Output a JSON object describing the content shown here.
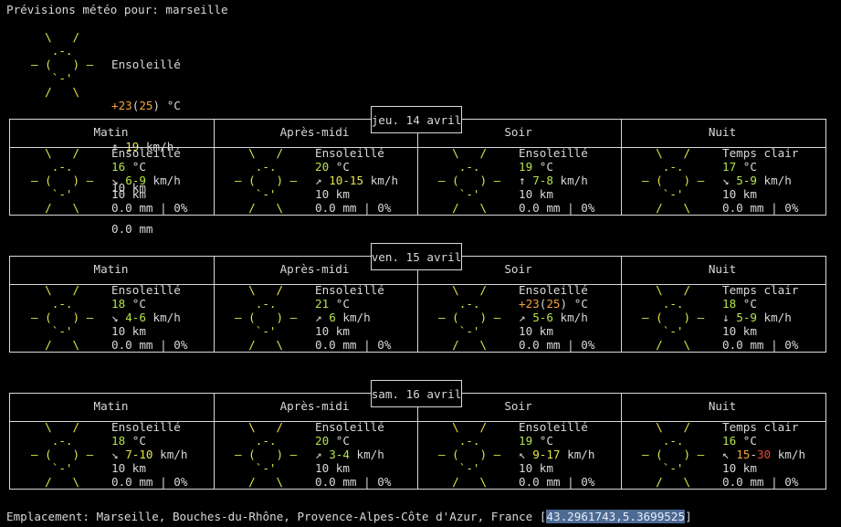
{
  "header": {
    "title": "Prévisions météo pour: marseille"
  },
  "current": {
    "art": "  \\   /\n   .-.\n― (   ) ―\n   `-'\n  /   \\",
    "condition": "Ensoleillé",
    "temp": "+23",
    "temp_feels": "25",
    "temp_unit": " °C",
    "wind_arrow": "↑",
    "wind_speed": "19",
    "wind_unit": " km/h",
    "visibility": "10 km",
    "precip": "0.0 mm"
  },
  "period_headers": [
    "Matin",
    "Après-midi",
    "Soir",
    "Nuit"
  ],
  "days": [
    {
      "date": "jeu. 14 avril",
      "periods": [
        {
          "condition": "Ensoleillé",
          "temp": "16",
          "temp_unit": " °C",
          "wind_arrow": "↘",
          "wind": "6-9",
          "wind_unit": " km/h",
          "visibility": "10 km",
          "precip": "0.0 mm | 0%",
          "art": "  \\   /\n   .-.\n― (   ) ―\n   `-'\n  /   \\"
        },
        {
          "condition": "Ensoleillé",
          "temp": "20",
          "temp_unit": " °C",
          "wind_arrow": "↗",
          "wind": "10-15",
          "wind_unit": " km/h",
          "visibility": "10 km",
          "precip": "0.0 mm | 0%",
          "art": "  \\   /\n   .-.\n― (   ) ―\n   `-'\n  /   \\"
        },
        {
          "condition": "Ensoleillé",
          "temp": "19",
          "temp_unit": " °C",
          "wind_arrow": "↑",
          "wind": "7-8",
          "wind_unit": " km/h",
          "visibility": "10 km",
          "precip": "0.0 mm | 0%",
          "art": "  \\   /\n   .-.\n― (   ) ―\n   `-'\n  /   \\"
        },
        {
          "condition": "Temps clair",
          "temp": "17",
          "temp_unit": " °C",
          "wind_arrow": "↘",
          "wind": "5-9",
          "wind_unit": " km/h",
          "visibility": "10 km",
          "precip": "0.0 mm | 0%",
          "art": "  \\   /\n   .-.\n― (   ) ―\n   `-'\n  /   \\"
        }
      ]
    },
    {
      "date": "ven. 15 avril",
      "periods": [
        {
          "condition": "Ensoleillé",
          "temp": "18",
          "temp_unit": " °C",
          "wind_arrow": "↘",
          "wind": "4-6",
          "wind_unit": " km/h",
          "visibility": "10 km",
          "precip": "0.0 mm | 0%",
          "art": "  \\   /\n   .-.\n― (   ) ―\n   `-'\n  /   \\"
        },
        {
          "condition": "Ensoleillé",
          "temp": "21",
          "temp_unit": " °C",
          "wind_arrow": "↗",
          "wind": "6",
          "wind_unit": " km/h",
          "visibility": "10 km",
          "precip": "0.0 mm | 0%",
          "art": "  \\   /\n   .-.\n― (   ) ―\n   `-'\n  /   \\"
        },
        {
          "condition": "Ensoleillé",
          "temp": "+23",
          "temp_feels": "25",
          "temp_unit": " °C",
          "wind_arrow": "↗",
          "wind": "5-6",
          "wind_unit": " km/h",
          "visibility": "10 km",
          "precip": "0.0 mm | 0%",
          "art": "  \\   /\n   .-.\n― (   ) ―\n   `-'\n  /   \\"
        },
        {
          "condition": "Temps clair",
          "temp": "18",
          "temp_unit": " °C",
          "wind_arrow": "↓",
          "wind": "5-9",
          "wind_unit": " km/h",
          "visibility": "10 km",
          "precip": "0.0 mm | 0%",
          "art": "  \\   /\n   .-.\n― (   ) ―\n   `-'\n  /   \\"
        }
      ]
    },
    {
      "date": "sam. 16 avril",
      "periods": [
        {
          "condition": "Ensoleillé",
          "temp": "18",
          "temp_unit": " °C",
          "wind_arrow": "↘",
          "wind": "7-10",
          "wind_unit": " km/h",
          "visibility": "10 km",
          "precip": "0.0 mm | 0%",
          "art": "  \\   /\n   .-.\n― (   ) ―\n   `-'\n  /   \\"
        },
        {
          "condition": "Ensoleillé",
          "temp": "20",
          "temp_unit": " °C",
          "wind_arrow": "↗",
          "wind": "3-4",
          "wind_unit": " km/h",
          "visibility": "10 km",
          "precip": "0.0 mm | 0%",
          "art": "  \\   /\n   .-.\n― (   ) ―\n   `-'\n  /   \\"
        },
        {
          "condition": "Ensoleillé",
          "temp": "19",
          "temp_unit": " °C",
          "wind_arrow": "↖",
          "wind": "9-17",
          "wind_unit": " km/h",
          "visibility": "10 km",
          "precip": "0.0 mm | 0%",
          "art": "  \\   /\n   .-.\n― (   ) ―\n   `-'\n  /   \\"
        },
        {
          "condition": "Temps clair",
          "temp": "16",
          "temp_unit": " °C",
          "wind_arrow": "↖",
          "wind_lo": "15",
          "wind_hi": "30",
          "wind_unit": " km/h",
          "visibility": "10 km",
          "precip": "0.0 mm | 0%",
          "art": "  \\   /\n   .-.\n― (   ) ―\n   `-'\n  /   \\"
        }
      ]
    }
  ],
  "footer": {
    "location_prefix": "Emplacement: Marseille, Bouches-du-Rhône, Provence-Alpes-Côte d'Azur, France [",
    "coords": "43.2961743,5.3699525",
    "suffix": "]"
  },
  "colors": {
    "background": "#000000",
    "text": "#d8d8d8",
    "sun": "#e4e44a",
    "temp_mild": "#b4e34a",
    "temp_warm": "#f2a33c",
    "wind_strong": "#ef4535",
    "selection": "#4d6a93"
  }
}
